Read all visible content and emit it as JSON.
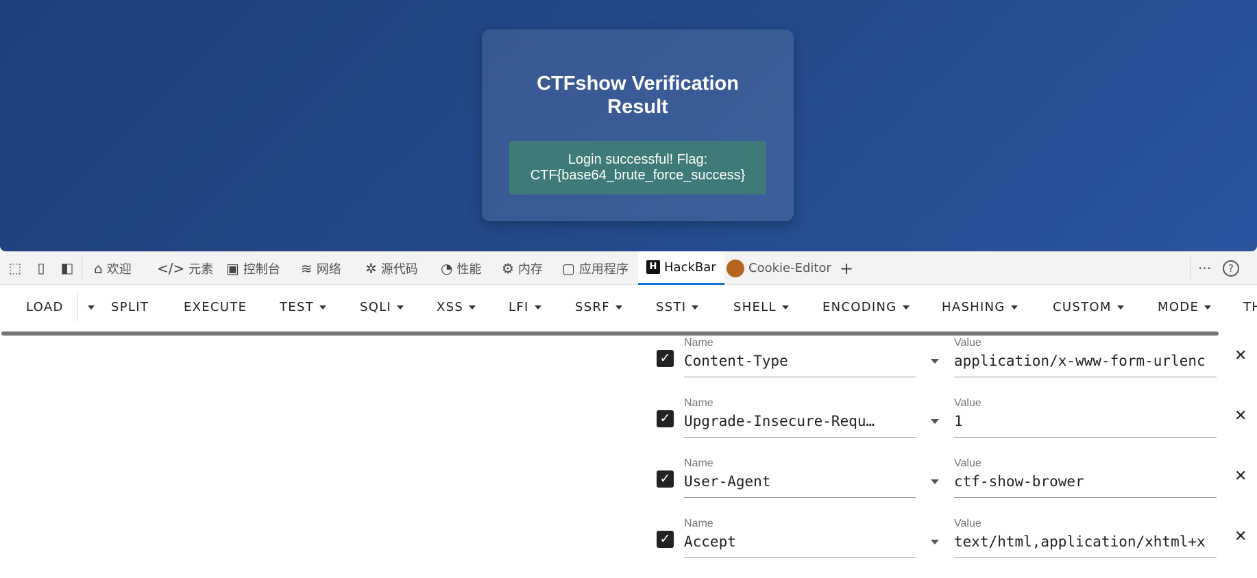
{
  "page": {
    "card_title": "CTFshow Verification Result",
    "result_text": "Login successful! Flag: CTF{base64_brute_force_success}"
  },
  "devtools": {
    "tabs": [
      {
        "label": "欢迎",
        "icon": "home-icon"
      },
      {
        "label": "元素",
        "icon": "code-icon"
      },
      {
        "label": "控制台",
        "icon": "console-icon"
      },
      {
        "label": "网络",
        "icon": "wifi-icon"
      },
      {
        "label": "源代码",
        "icon": "bug-icon"
      },
      {
        "label": "性能",
        "icon": "gauge-icon"
      },
      {
        "label": "内存",
        "icon": "chip-icon"
      },
      {
        "label": "应用程序",
        "icon": "window-icon"
      },
      {
        "label": "HackBar",
        "icon": "hackbar-logo-icon"
      },
      {
        "label": "Cookie-Editor",
        "icon": "cookie-icon"
      }
    ],
    "add_tab": "+",
    "more": "···",
    "help": "?"
  },
  "hackbar": {
    "buttons": [
      "LOAD",
      "SPLIT",
      "EXECUTE",
      "TEST",
      "SQLI",
      "XSS",
      "LFI",
      "SSRF",
      "SSTI",
      "SHELL",
      "ENCODING",
      "HASHING",
      "CUSTOM",
      "MODE",
      "TH"
    ],
    "headers": [
      {
        "name_label": "Name",
        "name": "Content-Type",
        "value_label": "Value",
        "value": "application/x-www-form-urlenc"
      },
      {
        "name_label": "Name",
        "name": "Upgrade-Insecure-Requ…",
        "value_label": "Value",
        "value": "1"
      },
      {
        "name_label": "Name",
        "name": "User-Agent",
        "value_label": "Value",
        "value": "ctf-show-brower"
      },
      {
        "name_label": "Name",
        "name": "Accept",
        "value_label": "Value",
        "value": "text/html,application/xhtml+x"
      }
    ],
    "delete_glyph": "✕",
    "check_glyph": "✓"
  }
}
